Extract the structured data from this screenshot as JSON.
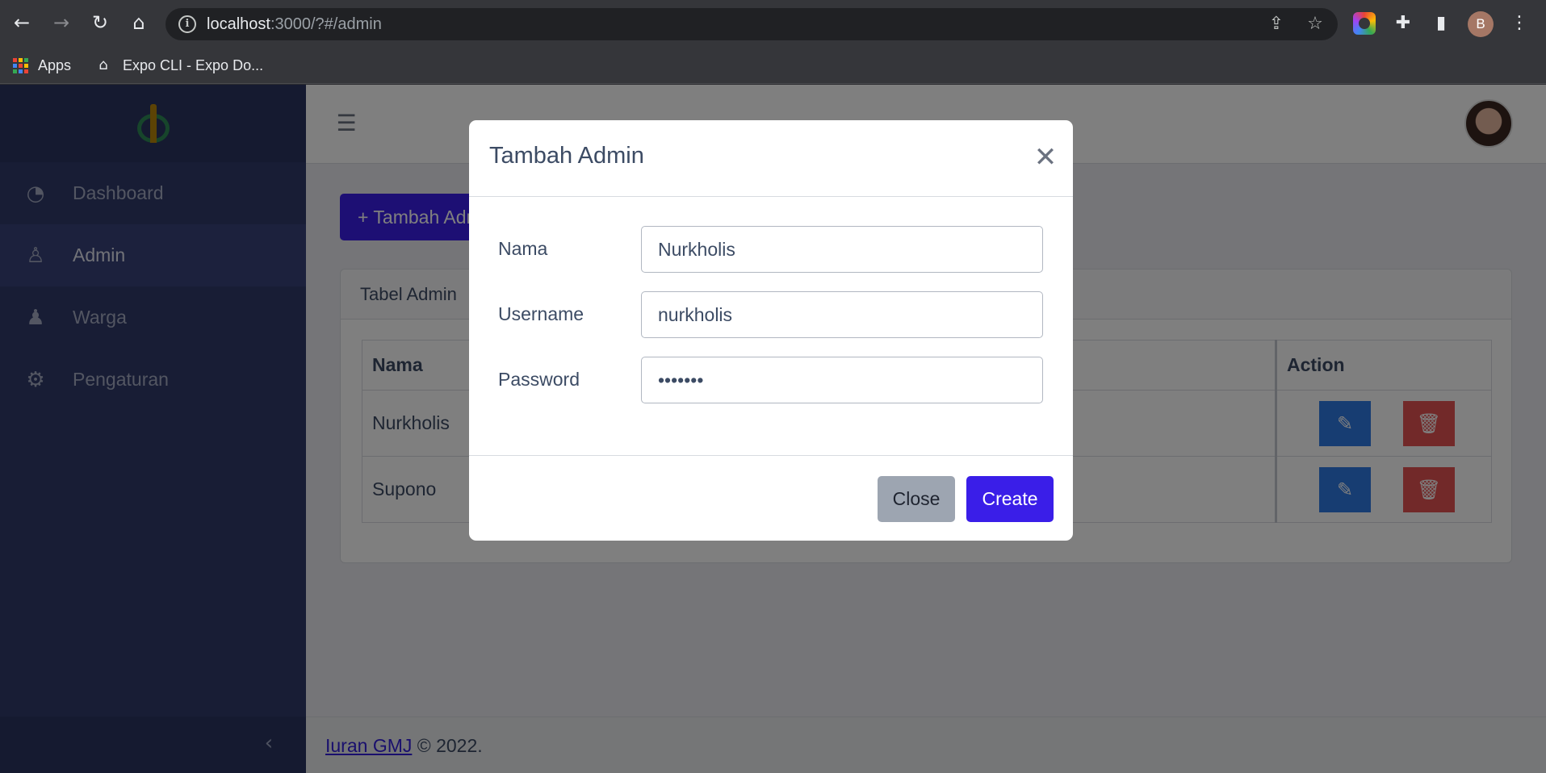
{
  "browser": {
    "url_host": "localhost",
    "url_rest": ":3000/?#/admin",
    "profile_initial": "B",
    "bookmarks": [
      {
        "label": "Apps"
      },
      {
        "label": "Expo CLI - Expo Do..."
      }
    ]
  },
  "sidebar": {
    "items": [
      {
        "label": "Dashboard",
        "icon": "speedometer-icon"
      },
      {
        "label": "Admin",
        "icon": "user-plus-icon",
        "active": true
      },
      {
        "label": "Warga",
        "icon": "people-icon"
      },
      {
        "label": "Pengaturan",
        "icon": "gear-icon"
      }
    ]
  },
  "main": {
    "add_button_label": "+ Tambah Admin",
    "card_title": "Tabel Admin",
    "table": {
      "columns": [
        "Nama",
        "Action"
      ],
      "rows": [
        {
          "nama": "Nurkholis"
        },
        {
          "nama": "Supono"
        }
      ]
    }
  },
  "footer": {
    "link_text": "Iuran GMJ",
    "suffix": "© 2022."
  },
  "modal": {
    "title": "Tambah Admin",
    "fields": [
      {
        "label": "Nama",
        "value": "Nurkholis"
      },
      {
        "label": "Username",
        "value": "nurkholis"
      },
      {
        "label": "Password",
        "value": "•••••••"
      }
    ],
    "close_label": "Close",
    "create_label": "Create"
  },
  "colors": {
    "primary": "#3a1ee8",
    "sidebar": "#303b6a",
    "edit": "#2f7ae5",
    "delete": "#e55353"
  }
}
